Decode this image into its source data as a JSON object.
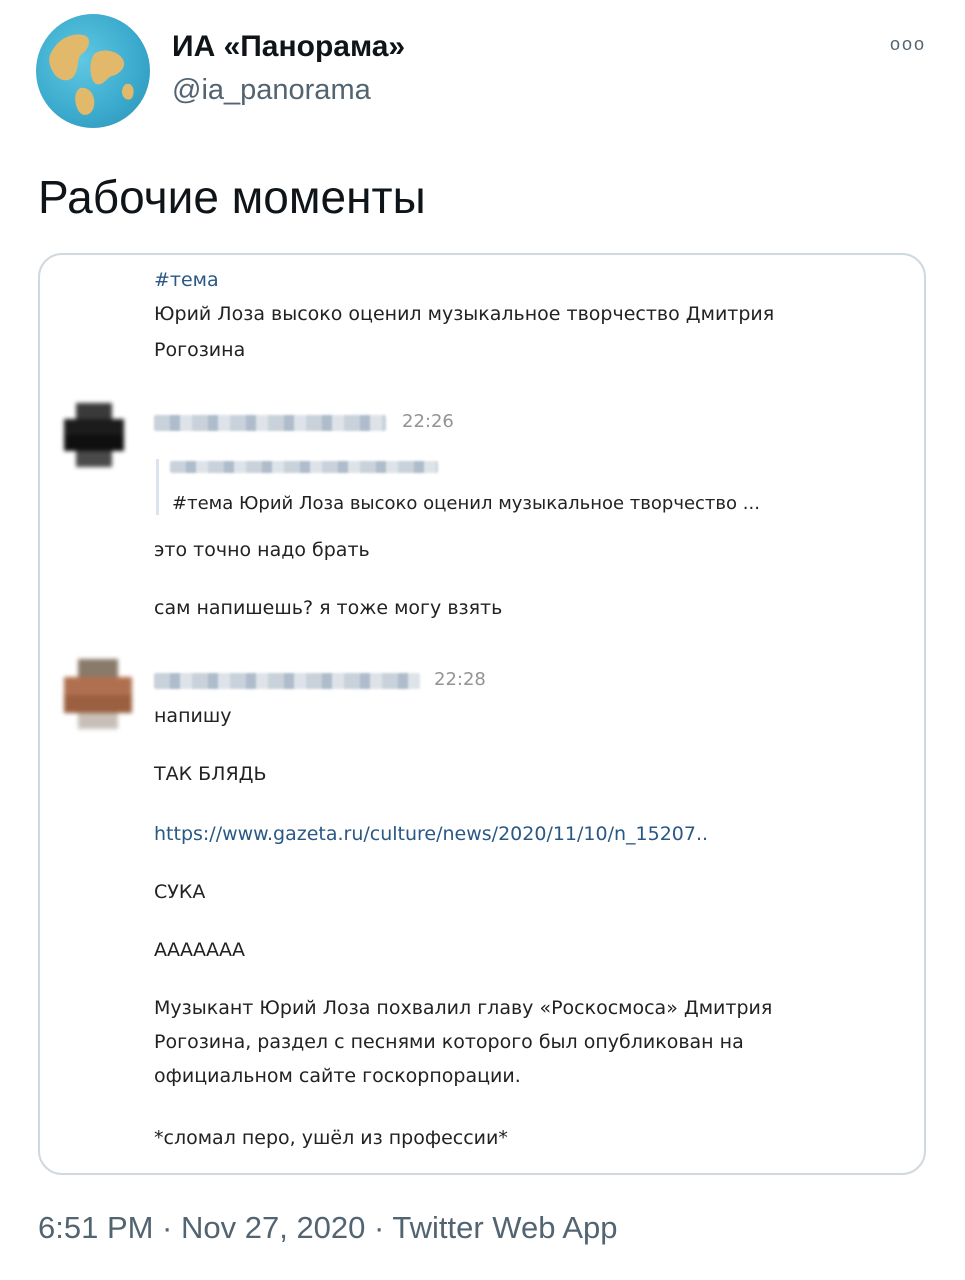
{
  "account": {
    "name": "ИА «Панорама»",
    "handle": "@ia_panorama"
  },
  "tweet": {
    "text": "Рабочие моменты",
    "footer": "6:51 PM · Nov 27, 2020 · Twitter Web App"
  },
  "screenshot": {
    "post": {
      "hashtag": "#тема",
      "line1": "Юрий Лоза высоко оценил музыкальное творчество Дмитрия",
      "line2": "Рогозина"
    },
    "message1": {
      "time": "22:26",
      "reply_text": "#тема Юрий Лоза высоко оценил музыкальное творчество ...",
      "lines": [
        "это точно надо брать",
        "сам напишешь? я тоже могу взять"
      ]
    },
    "message2": {
      "time": "22:28",
      "lines": [
        "напишу",
        "ТАК БЛЯДЬ"
      ],
      "link": "https://www.gazeta.ru/culture/news/2020/11/10/n_15207..",
      "lines2": [
        "СУКА",
        "ААААААА"
      ],
      "preview": [
        "Музыкант Юрий Лоза похвалил главу «Роскосмоса» Дмитрия",
        "Рогозина, раздел с песнями которого был опубликован на",
        "официальном сайте госкорпорации."
      ],
      "last": "*сломал перо, ушёл из профессии*"
    }
  }
}
